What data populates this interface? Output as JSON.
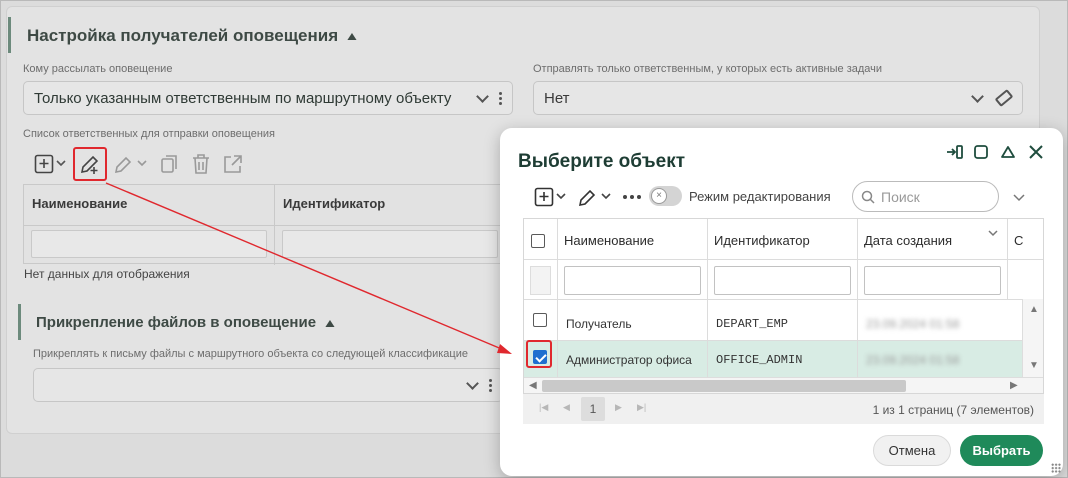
{
  "section_notify": {
    "title": "Настройка получателей оповещения",
    "send_to_label": "Кому рассылать оповещение",
    "send_to_value": "Только указанным ответственным по маршрутному объекту",
    "only_active_label": "Отправлять только ответственным, у которых есть активные задачи",
    "only_active_value": "Нет",
    "responsible_list_label": "Список ответственных для отправки оповещения",
    "table_headers": [
      "Наименование",
      "Идентификатор"
    ],
    "no_data": "Нет данных для отображения"
  },
  "section_files": {
    "title": "Прикрепление файлов в оповещение",
    "attach_label": "Прикреплять к письму файлы с маршрутного объекта со следующей классификацие"
  },
  "dialog": {
    "title": "Выберите объект",
    "edit_mode_label": "Режим редактирования",
    "search_placeholder": "Поиск",
    "columns": [
      "Наименование",
      "Идентификатор",
      "Дата создания",
      "С"
    ],
    "rows": [
      {
        "name": "Получатель",
        "id": "DEPART_EMP",
        "date": "23.09.2024 01:58",
        "checked": false
      },
      {
        "name": "Администратор офиса",
        "id": "OFFICE_ADMIN",
        "date": "23.09.2024 01:58",
        "checked": true
      }
    ],
    "pager": {
      "current_page": "1",
      "info": "1 из 1 страниц (7 элементов)"
    },
    "cancel_label": "Отмена",
    "select_label": "Выбрать"
  },
  "colors": {
    "accent_green": "#1f8a5a",
    "highlight_red": "#e0282e",
    "selected_row": "#d8ece4",
    "checkbox_blue": "#1f6fcf"
  }
}
